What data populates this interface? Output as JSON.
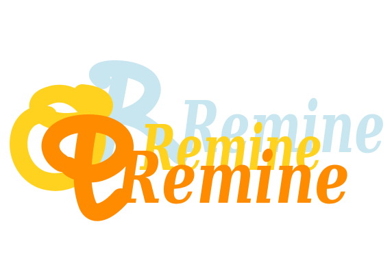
{
  "logo": {
    "text": "Remine",
    "colors": {
      "background": "#ffffff",
      "back_layer": "#c8e6f0",
      "middle_layer": "#ffd21f",
      "front_layer": "#ff8c00"
    }
  }
}
